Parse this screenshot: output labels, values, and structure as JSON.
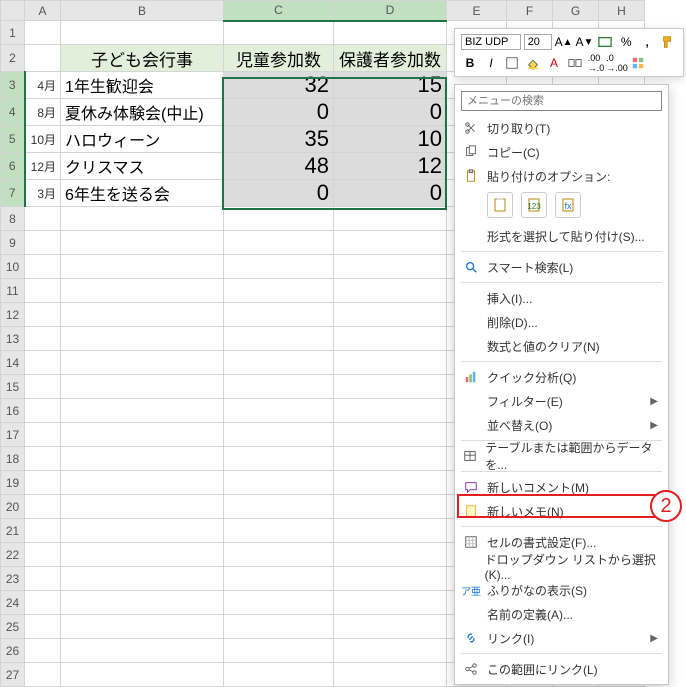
{
  "columns": [
    "A",
    "B",
    "C",
    "D",
    "E",
    "F",
    "G",
    "H"
  ],
  "row_count": 27,
  "selected_columns": [
    "C",
    "D"
  ],
  "selected_rows": [
    3,
    4,
    5,
    6,
    7
  ],
  "headers": {
    "event_col": "子ども会行事",
    "children_col": "児童参加数",
    "guardians_col": "保護者参加数"
  },
  "rows": [
    {
      "month": "4月",
      "event": "1年生歓迎会",
      "children": "32",
      "guardians": "15"
    },
    {
      "month": "8月",
      "event": "夏休み体験会(中止)",
      "children": "0",
      "guardians": "0"
    },
    {
      "month": "10月",
      "event": "ハロウィーン",
      "children": "35",
      "guardians": "10"
    },
    {
      "month": "12月",
      "event": "クリスマス",
      "children": "48",
      "guardians": "12"
    },
    {
      "month": "3月",
      "event": "6年生を送る会",
      "children": "0",
      "guardians": "0"
    }
  ],
  "mini_toolbar": {
    "font": "BIZ UDP",
    "size": "20"
  },
  "context_menu": {
    "search_placeholder": "メニューの検索",
    "cut": "切り取り(T)",
    "copy": "コピー(C)",
    "paste_options": "貼り付けのオプション:",
    "paste_special": "形式を選択して貼り付け(S)...",
    "smart_lookup": "スマート検索(L)",
    "insert": "挿入(I)...",
    "delete": "削除(D)...",
    "clear": "数式と値のクリア(N)",
    "quick_analysis": "クイック分析(Q)",
    "filter": "フィルター(E)",
    "sort": "並べ替え(O)",
    "table_range": "テーブルまたは範囲からデータを...",
    "new_comment": "新しいコメント(M)",
    "new_note": "新しいメモ(N)",
    "format_cells": "セルの書式設定(F)...",
    "dropdown": "ドロップダウン リストから選択(K)...",
    "phonetic": "ふりがなの表示(S)",
    "define_name": "名前の定義(A)...",
    "link": "リンク(I)",
    "link_range": "この範囲にリンク(L)"
  },
  "annotation": {
    "number": "2"
  }
}
